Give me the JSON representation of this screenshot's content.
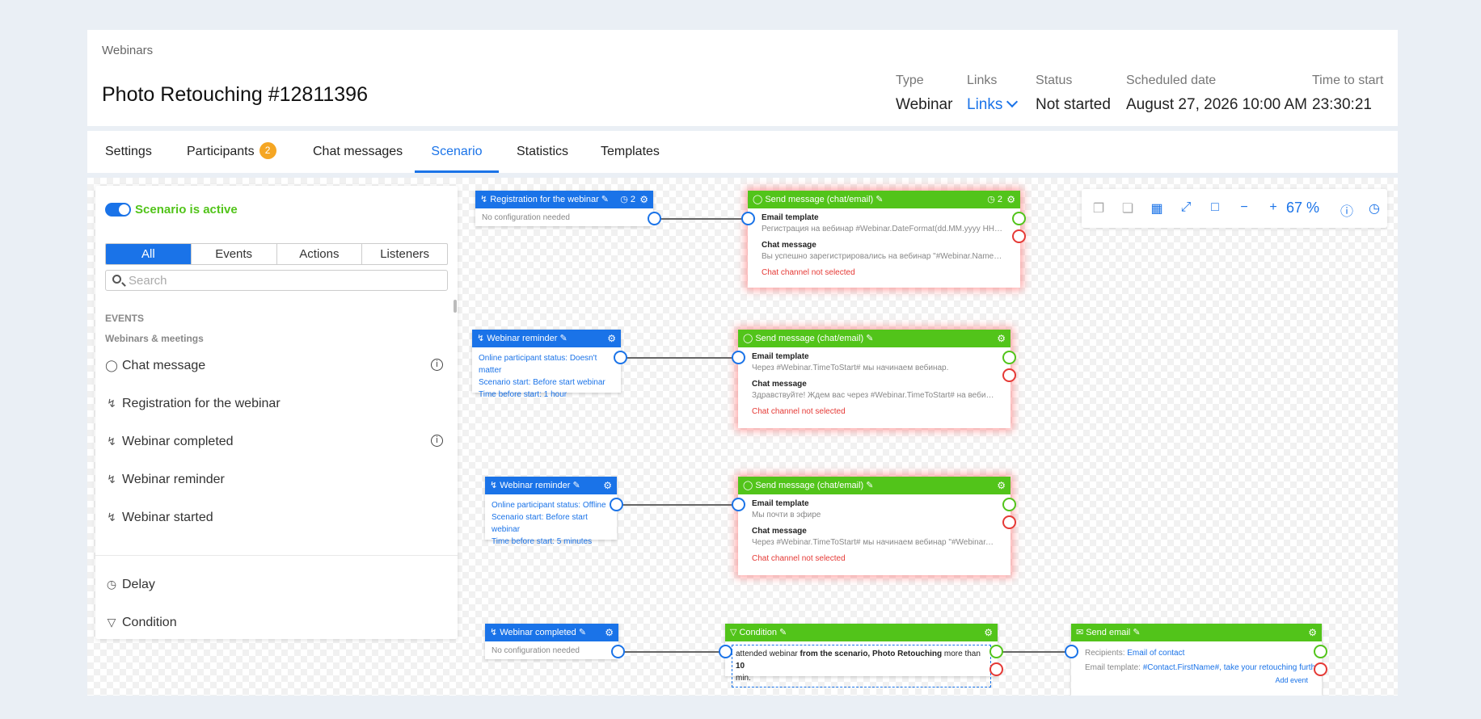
{
  "header": {
    "breadcrumb": "Webinars",
    "title": "Photo Retouching #12811396",
    "meta": [
      {
        "label": "Type",
        "value": "Webinar"
      },
      {
        "label": "Links",
        "value": "Links"
      },
      {
        "label": "Status",
        "value": "Not started"
      },
      {
        "label": "Scheduled date",
        "value": "August 27, 2026 10:00 AM"
      },
      {
        "label": "Time to start",
        "value": "23:30:21"
      }
    ]
  },
  "tabs": [
    {
      "label": "Settings"
    },
    {
      "label": "Participants",
      "badge": "2"
    },
    {
      "label": "Chat messages"
    },
    {
      "label": "Scenario",
      "active": true
    },
    {
      "label": "Statistics"
    },
    {
      "label": "Templates"
    }
  ],
  "panel": {
    "active_label": "Scenario is active",
    "filters": [
      "All",
      "Events",
      "Actions",
      "Listeners"
    ],
    "search_placeholder": "Search",
    "section_events": "EVENTS",
    "section_sub": "Webinars & meetings",
    "items": [
      {
        "label": "Chat message",
        "icon": "chat-bubble-icon",
        "info": true
      },
      {
        "label": "Registration for the webinar",
        "icon": "lightning-icon"
      },
      {
        "label": "Webinar completed",
        "icon": "lightning-icon",
        "info": true
      },
      {
        "label": "Webinar reminder",
        "icon": "lightning-icon"
      },
      {
        "label": "Webinar started",
        "icon": "lightning-icon"
      }
    ],
    "extra_items": [
      {
        "label": "Delay",
        "icon": "clock-icon"
      },
      {
        "label": "Condition",
        "icon": "filter-icon"
      }
    ]
  },
  "nodes": {
    "reg": {
      "title": "Registration for the webinar",
      "count": "2",
      "body": "No configuration needed"
    },
    "send1": {
      "title": "Send message (chat/email)",
      "count": "2",
      "email_label": "Email template",
      "email_value": "Регистрация на вебинар #Webinar.DateFormat(dd.MM.yyyy HH:mm)# #...",
      "chat_label": "Chat message",
      "chat_value": "Вы успешно зарегистрировались на вебинар \"#Webinar.Name#\". Дата и...",
      "error": "Chat channel not selected"
    },
    "rem1": {
      "title": "Webinar reminder",
      "lines": [
        "Online participant status: Doesn't matter",
        "Scenario start: Before start webinar",
        "Time before start: 1 hour"
      ]
    },
    "send2": {
      "title": "Send message (chat/email)",
      "email_label": "Email template",
      "email_value": "Через #Webinar.TimeToStart# мы начинаем вебинар.",
      "chat_label": "Chat message",
      "chat_value": "Здравствуйте! Ждем вас через #Webinar.TimeToStart# на вебинаре \"#W...",
      "error": "Chat channel not selected"
    },
    "rem2": {
      "title": "Webinar reminder",
      "lines": [
        "Online participant status: Offline",
        "Scenario start: Before start webinar",
        "Time before start: 5 minutes"
      ]
    },
    "send3": {
      "title": "Send message (chat/email)",
      "email_label": "Email template",
      "email_value": "Мы почти в эфире",
      "chat_label": "Chat message",
      "chat_value": "Через #Webinar.TimeToStart# мы начинаем вебинар \"#Webinar.Name#\"...",
      "error": "Chat channel not selected"
    },
    "comp": {
      "title": "Webinar completed",
      "body": "No configuration needed"
    },
    "cond": {
      "title": "Condition",
      "t1": "attended webinar ",
      "t2": "from the scenario,",
      "t3": " Photo Retouching",
      "t4": " more than ",
      "t5": "10",
      "t6": "min."
    },
    "email": {
      "title": "Send email",
      "rec_label": "Recipients:",
      "rec_value": "Email of contact",
      "tpl_label": "Email template:",
      "tpl_value": "#Contact.FirstName#, take your retouching further",
      "add_event": "Add event"
    }
  },
  "toolbar": {
    "zoom": "67 %"
  }
}
